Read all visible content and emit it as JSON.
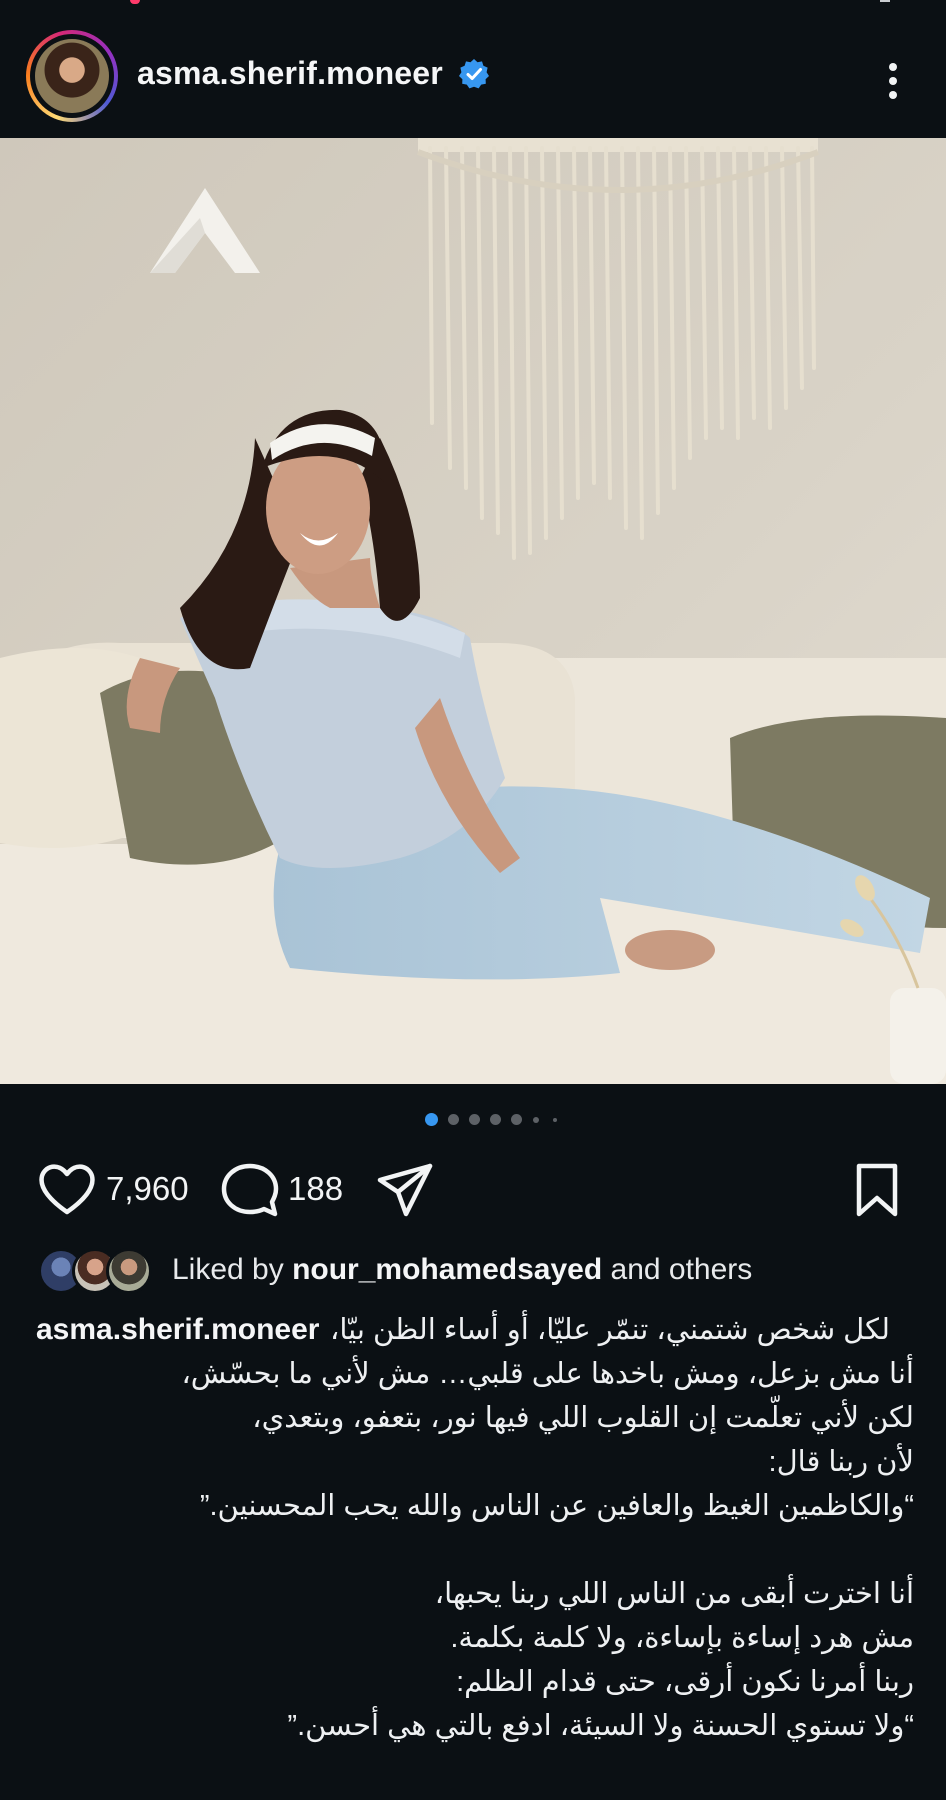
{
  "header": {
    "username": "asma.sherif.moneer",
    "avatar": "profile-avatar",
    "verified_icon": "verified-badge-icon",
    "more_icon": "more-options-icon"
  },
  "post": {
    "image": "photo-woman-sitting-on-sofa",
    "carousel": {
      "total_dots": 7,
      "active_index": 0
    }
  },
  "actions": {
    "like_icon": "heart-icon",
    "like_count": "7,960",
    "comment_icon": "comment-icon",
    "comment_count": "188",
    "share_icon": "share-icon",
    "save_icon": "bookmark-icon"
  },
  "likes": {
    "prefix": "Liked by ",
    "user": "nour_mohamedsayed",
    "suffix": " and others"
  },
  "caption": {
    "username": "asma.sherif.moneer",
    "lines": [
      "لكل شخص شتمني، تنمّر عليّا، أو أساء الظن بيّا،",
      "أنا مش بزعل، ومش باخدها على قلبي… مش لأني ما بحسّش،",
      "لكن لأني تعلّمت إن القلوب اللي فيها نور، بتعفو، وبتعدي،",
      "لأن ربنا قال:",
      "“والكاظمين الغيظ والعافين عن الناس والله يحب المحسنين.”",
      "",
      "أنا اخترت أبقى من الناس اللي ربنا يحبها،",
      "مش هرد إساءة بإساءة، ولا كلمة بكلمة.",
      "ربنا أمرنا نكون أرقى، حتى قدام الظلم:",
      "“ولا تستوي الحسنة ولا السيئة، ادفع بالتي هي أحسن.”"
    ]
  },
  "colors": {
    "background": "#0b1014",
    "text": "#f2f4f5",
    "verified": "#3797f0",
    "active_dot": "#3797f0",
    "inactive_dot": "#5d6166"
  }
}
